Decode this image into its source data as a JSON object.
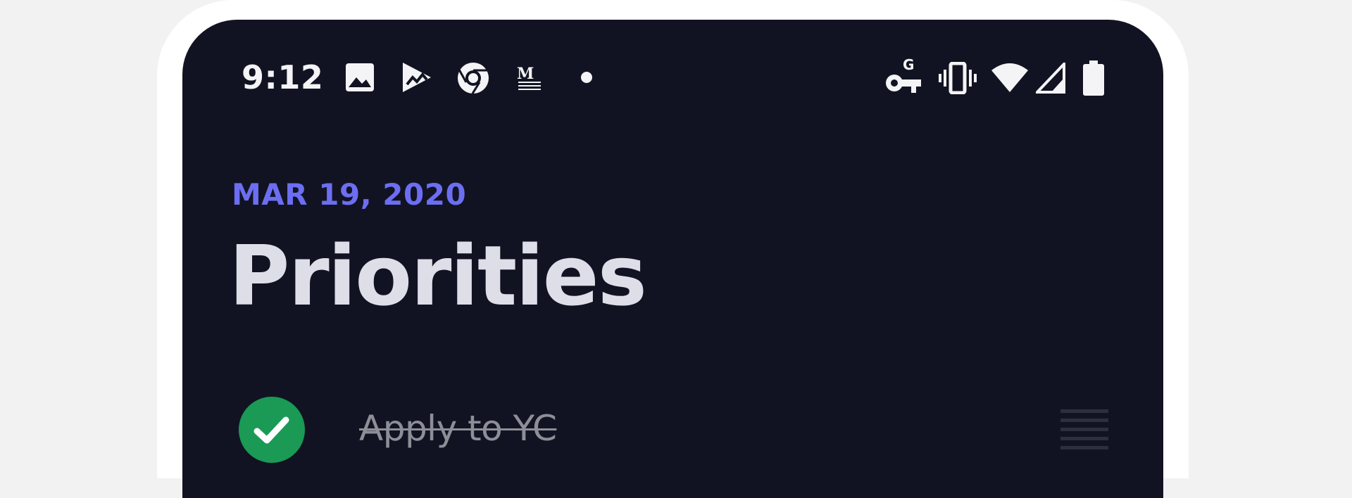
{
  "status_bar": {
    "time": "9:12",
    "left_icons": [
      "image-icon",
      "play-store-icon",
      "chrome-icon",
      "medium-icon",
      "dot-icon"
    ],
    "right_icons": [
      "vpn-key-icon",
      "vibrate-icon",
      "wifi-icon",
      "cellular-icon",
      "battery-icon"
    ]
  },
  "header": {
    "date": "MAR 19, 2020",
    "title": "Priorities"
  },
  "tasks": [
    {
      "label": "Apply to YC",
      "completed": true
    }
  ],
  "colors": {
    "page_background": "#f2f2f2",
    "screen_background": "#121322",
    "accent": "#6c6ef2",
    "title": "#dedee9",
    "done_check": "#1a9a55",
    "done_text": "#8d8e97"
  }
}
